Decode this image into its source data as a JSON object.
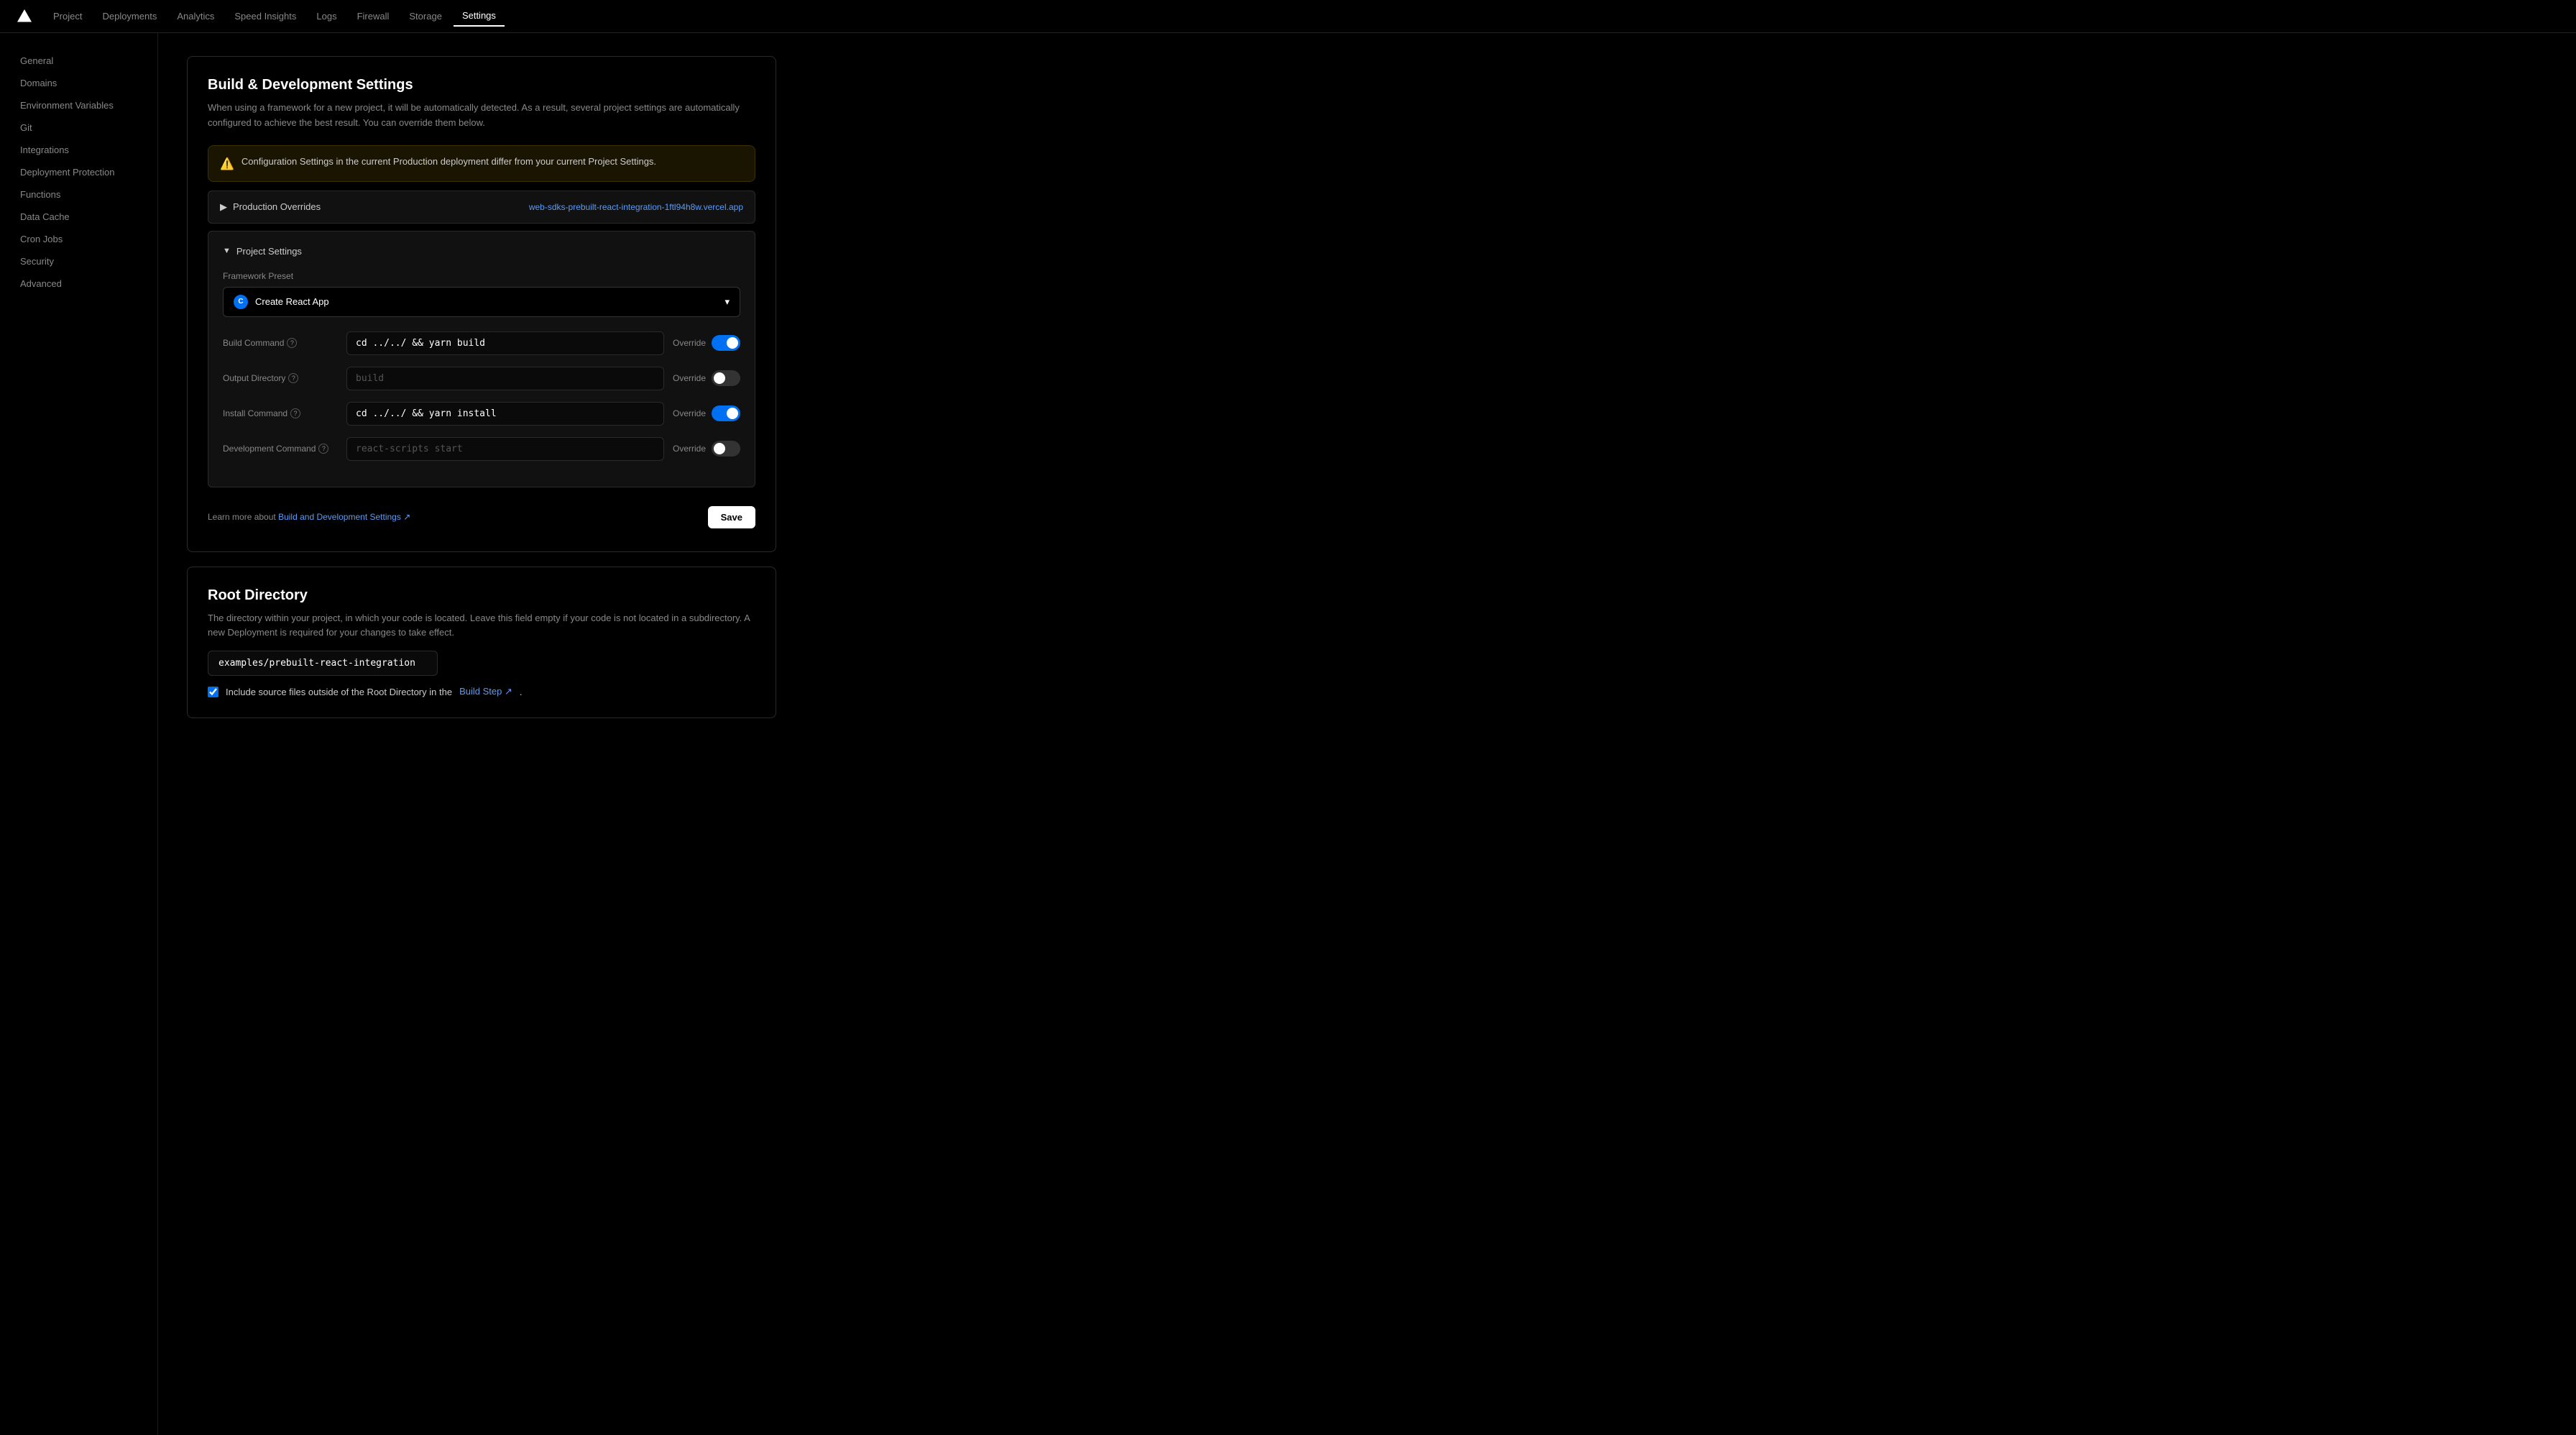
{
  "nav": {
    "logo_alt": "Vercel",
    "items": [
      {
        "label": "Project",
        "active": false
      },
      {
        "label": "Deployments",
        "active": false
      },
      {
        "label": "Analytics",
        "active": false
      },
      {
        "label": "Speed Insights",
        "active": false
      },
      {
        "label": "Logs",
        "active": false
      },
      {
        "label": "Firewall",
        "active": false
      },
      {
        "label": "Storage",
        "active": false
      },
      {
        "label": "Settings",
        "active": true
      }
    ]
  },
  "sidebar": {
    "items": [
      {
        "label": "General",
        "active": false
      },
      {
        "label": "Domains",
        "active": false
      },
      {
        "label": "Environment Variables",
        "active": false
      },
      {
        "label": "Git",
        "active": false
      },
      {
        "label": "Integrations",
        "active": false
      },
      {
        "label": "Deployment Protection",
        "active": false
      },
      {
        "label": "Functions",
        "active": false
      },
      {
        "label": "Data Cache",
        "active": false
      },
      {
        "label": "Cron Jobs",
        "active": false
      },
      {
        "label": "Security",
        "active": false
      },
      {
        "label": "Advanced",
        "active": false
      }
    ]
  },
  "build_section": {
    "title": "Build & Development Settings",
    "description": "When using a framework for a new project, it will be automatically detected. As a result, several project settings are automatically configured to achieve the best result. You can override them below.",
    "warning": "Configuration Settings in the current Production deployment differ from your current Project Settings.",
    "production_overrides_label": "Production Overrides",
    "production_link": "web-sdks-prebuilt-react-integration-1ftl94h8w.vercel.app",
    "project_settings_label": "Project Settings",
    "framework_preset_label": "Framework Preset",
    "framework_value": "Create React App",
    "build_command_label": "Build Command",
    "build_command_value": "cd ../../ && yarn build",
    "output_directory_label": "Output Directory",
    "output_directory_placeholder": "build",
    "install_command_label": "Install Command",
    "install_command_value": "cd ../../ && yarn install",
    "dev_command_label": "Development Command",
    "dev_command_placeholder": "react-scripts start",
    "override_label": "Override",
    "footer_text": "Learn more about",
    "footer_link_text": "Build and Development Settings",
    "save_label": "Save"
  },
  "root_section": {
    "title": "Root Directory",
    "description": "The directory within your project, in which your code is located. Leave this field empty if your code is not located in a subdirectory. A new Deployment is required for your changes to take effect.",
    "input_value": "examples/prebuilt-react-integration",
    "checkbox_label": "Include source files outside of the Root Directory in the",
    "checkbox_link": "Build Step",
    "checkbox_checked": true
  },
  "toggles": {
    "build_command_on": true,
    "output_directory_on": false,
    "install_command_on": true,
    "dev_command_on": false
  }
}
